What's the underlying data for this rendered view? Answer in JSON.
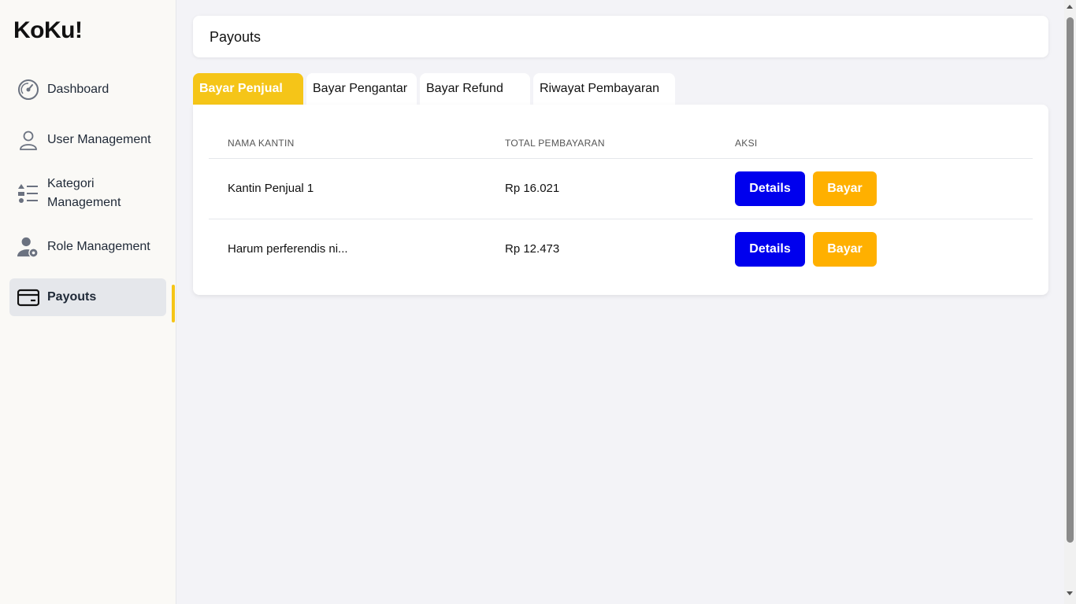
{
  "brand": "KoKu!",
  "sidebar": {
    "items": [
      {
        "label": "Dashboard",
        "icon": "speedometer-icon"
      },
      {
        "label": "User Management",
        "icon": "user-icon"
      },
      {
        "label": "Kategori Management",
        "icon": "list-icon"
      },
      {
        "label": "Role Management",
        "icon": "user-cog-icon"
      },
      {
        "label": "Payouts",
        "icon": "credit-card-icon",
        "active": true
      }
    ]
  },
  "header": {
    "title": "Payouts"
  },
  "tabs": [
    {
      "label": "Bayar Penjual",
      "active": true
    },
    {
      "label": "Bayar Pengantar"
    },
    {
      "label": "Bayar Refund"
    },
    {
      "label": "Riwayat Pembayaran"
    }
  ],
  "table": {
    "columns": [
      "NAMA KANTIN",
      "TOTAL PEMBAYARAN",
      "AKSI"
    ],
    "rows": [
      {
        "name": "Kantin Penjual 1",
        "total": "Rp 16.021",
        "details_label": "Details",
        "pay_label": "Bayar"
      },
      {
        "name": "Harum perferendis ni...",
        "total": "Rp 12.473",
        "details_label": "Details",
        "pay_label": "Bayar"
      }
    ]
  },
  "colors": {
    "accent": "#f5c518",
    "details": "#0000ee",
    "pay": "#ffb000"
  }
}
